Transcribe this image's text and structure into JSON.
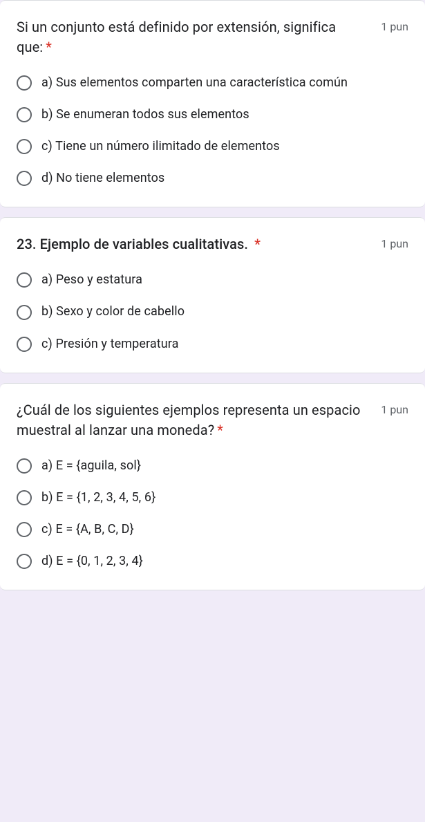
{
  "questions": [
    {
      "text": "Si un conjunto está definido por extensión, significa que:",
      "bold": false,
      "points": "1 pun",
      "options": [
        "a) Sus elementos comparten una característica común",
        "b) Se enumeran todos sus elementos",
        "c) Tiene un número ilimitado de elementos",
        "d) No tiene elementos"
      ]
    },
    {
      "text": "23. Ejemplo de variables cualitativas.",
      "bold": true,
      "points": "1 pun",
      "options": [
        "a) Peso y estatura",
        "b) Sexo y color de cabello",
        "c) Presión y temperatura"
      ]
    },
    {
      "text": "¿Cuál de los siguientes ejemplos representa un espacio muestral al lanzar una moneda?",
      "bold": false,
      "points": "1 pun",
      "options": [
        "a) E = {aguila, sol}",
        "b) E = {1, 2, 3, 4, 5, 6}",
        "c) E = {A, B, C, D}",
        "d) E = {0, 1, 2, 3, 4}"
      ]
    }
  ],
  "required_marker": "*"
}
